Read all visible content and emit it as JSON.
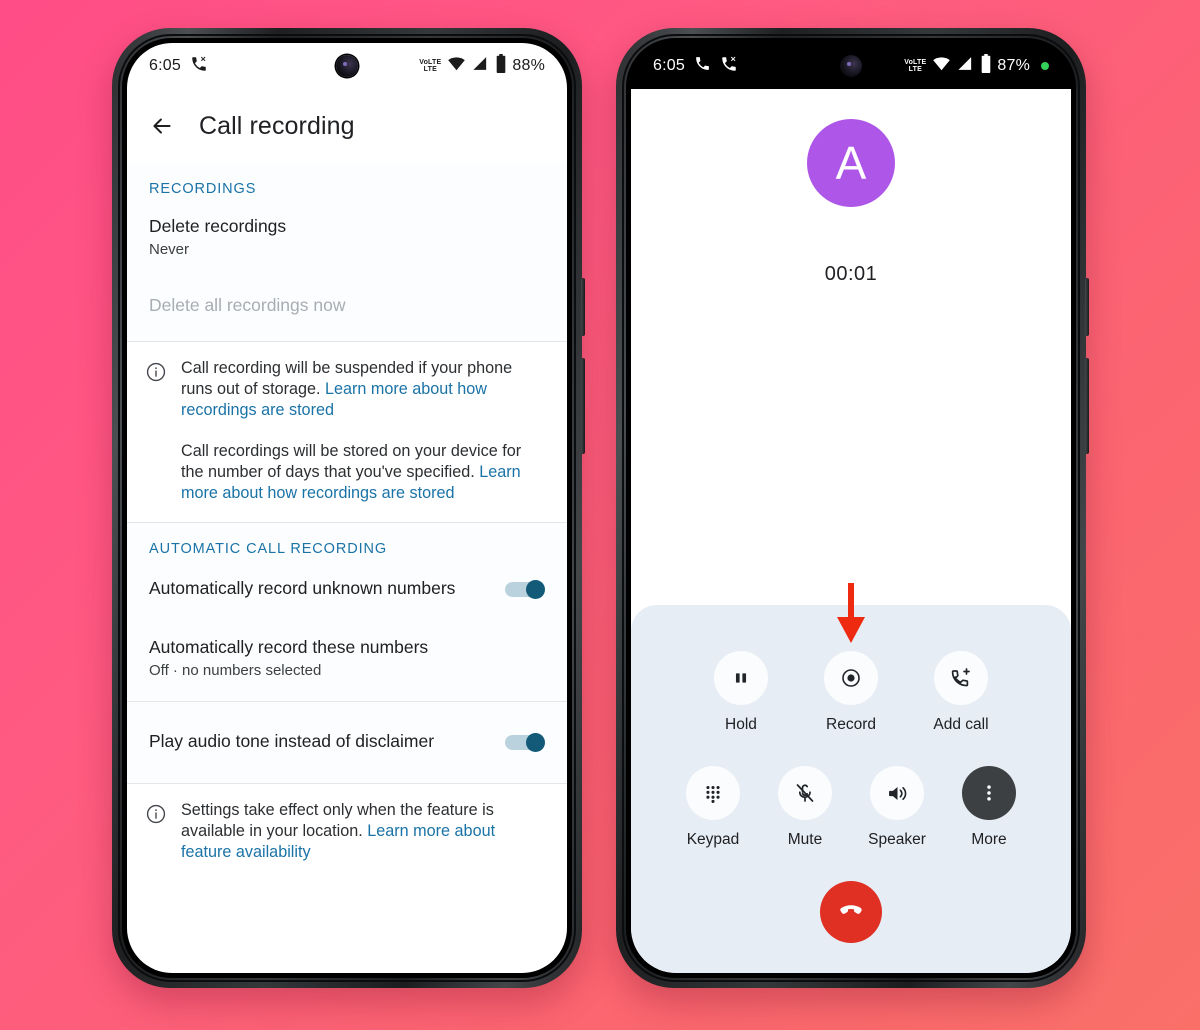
{
  "background": {
    "gradient_from": "#ff4d87",
    "gradient_to": "#fa7069"
  },
  "phone_left": {
    "status_bar": {
      "time": "6:05",
      "call_icon": "missed-call-forward-icon",
      "network_label": "VoLTE",
      "network_top": "VoLTE",
      "network_bottom": "LTE",
      "wifi_icon": "wifi-icon",
      "signal_icon": "cell-signal-icon",
      "battery_icon": "battery-icon",
      "battery_percent": "88%"
    },
    "appbar": {
      "back_icon": "back-arrow-icon",
      "title": "Call recording"
    },
    "sections": [
      {
        "header": "RECORDINGS",
        "rows": [
          {
            "title": "Delete recordings",
            "subtitle": "Never",
            "dim": false,
            "toggle": null
          },
          {
            "title": "Delete all recordings now",
            "subtitle": "",
            "dim": true,
            "toggle": null
          }
        ]
      },
      {
        "header": "AUTOMATIC CALL RECORDING",
        "rows": [
          {
            "title": "Automatically record unknown numbers",
            "subtitle": "",
            "dim": false,
            "toggle": "on"
          },
          {
            "title": "Automatically record these numbers",
            "subtitle": "Off · no numbers selected",
            "dim": false,
            "toggle": null
          }
        ]
      },
      {
        "header": "",
        "rows": [
          {
            "title": "Play audio tone instead of disclaimer",
            "subtitle": "",
            "dim": false,
            "toggle": "on"
          }
        ]
      }
    ],
    "info_block_1": {
      "icon": "info-icon",
      "paragraphs": [
        {
          "text": "Call recording will be suspended if your phone runs out of storage. ",
          "link": "Learn more about how recordings are stored"
        },
        {
          "text": "Call recordings will be stored on your device for the number of days that you've specified. ",
          "link": "Learn more about how recordings are stored"
        }
      ]
    },
    "info_block_2": {
      "icon": "info-icon",
      "paragraphs": [
        {
          "text": "Settings take effect only when the feature is available in your location. ",
          "link": "Learn more about feature availability"
        }
      ]
    },
    "toggle_colors": {
      "knob": "#125a77",
      "track": "#b9d2de"
    },
    "section_header_color": "#1a73a7",
    "link_color": "#1a73a7"
  },
  "phone_right": {
    "status_bar": {
      "time": "6:05",
      "call_icon_1": "phone-call-icon",
      "call_icon_2": "missed-call-forward-icon",
      "network_top": "VoLTE",
      "network_bottom": "LTE",
      "wifi_icon": "wifi-icon",
      "signal_icon": "cell-signal-icon",
      "battery_icon": "battery-icon",
      "battery_percent": "87%",
      "recording_dot": "green-status-dot"
    },
    "call": {
      "avatar_letter": "A",
      "avatar_color": "#ae56e8",
      "duration": "00:01"
    },
    "annotation": {
      "arrow": "red-down-arrow",
      "color": "#ee2a10",
      "points_to": "Record"
    },
    "controls_row_1": [
      {
        "label": "Hold",
        "icon": "pause-icon",
        "style": "light"
      },
      {
        "label": "Record",
        "icon": "record-icon",
        "style": "light"
      },
      {
        "label": "Add call",
        "icon": "add-call-icon",
        "style": "light"
      }
    ],
    "controls_row_2": [
      {
        "label": "Keypad",
        "icon": "dialpad-icon",
        "style": "light"
      },
      {
        "label": "Mute",
        "icon": "mic-off-icon",
        "style": "light"
      },
      {
        "label": "Speaker",
        "icon": "speaker-icon",
        "style": "light"
      },
      {
        "label": "More",
        "icon": "more-vertical-icon",
        "style": "dark"
      }
    ],
    "end_call": {
      "icon": "end-call-icon",
      "color": "#e03024"
    },
    "panel_color": "#e6edf4"
  }
}
